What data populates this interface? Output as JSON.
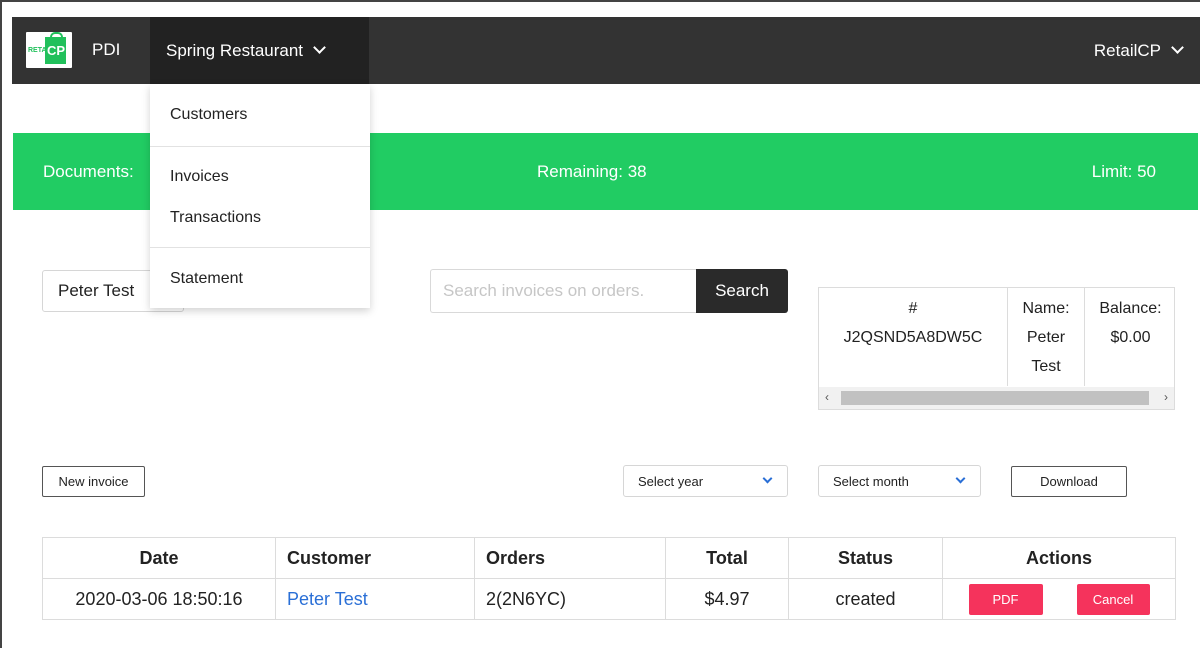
{
  "nav": {
    "logo_text": "RETAILCP",
    "logo_cp": "CP",
    "brand": "PDI",
    "restaurant": "Spring Restaurant",
    "account": "RetailCP"
  },
  "banner": {
    "documents": "Documents:",
    "remaining": "Remaining: 38",
    "limit": "Limit: 50",
    "color": "#21cc63"
  },
  "dropdown": {
    "items": [
      "Customers",
      "Invoices",
      "Transactions",
      "Statement"
    ]
  },
  "customer_select": {
    "value": "Peter Test"
  },
  "search": {
    "placeholder": "Search invoices on orders.",
    "button": "Search"
  },
  "info": {
    "id_label": "#",
    "id_value": "J2QSND5A8DW5C",
    "name_label": "Name:",
    "name_value1": "Peter",
    "name_value2": "Test",
    "balance_label": "Balance:",
    "balance_value": "$0.00"
  },
  "controls": {
    "new_invoice": "New invoice",
    "select_year": "Select year",
    "select_month": "Select month",
    "download": "Download"
  },
  "table": {
    "headers": [
      "Date",
      "Customer",
      "Orders",
      "Total",
      "Status",
      "Actions"
    ],
    "rows": [
      {
        "date": "2020-03-06 18:50:16",
        "customer": "Peter Test",
        "orders": "2(2N6YC)",
        "total": "$4.97",
        "status": "created",
        "pdf": "PDF",
        "cancel": "Cancel"
      }
    ]
  },
  "colors": {
    "accent_link": "#2a6fd6",
    "danger": "#f5335c",
    "topbar": "#333333"
  }
}
